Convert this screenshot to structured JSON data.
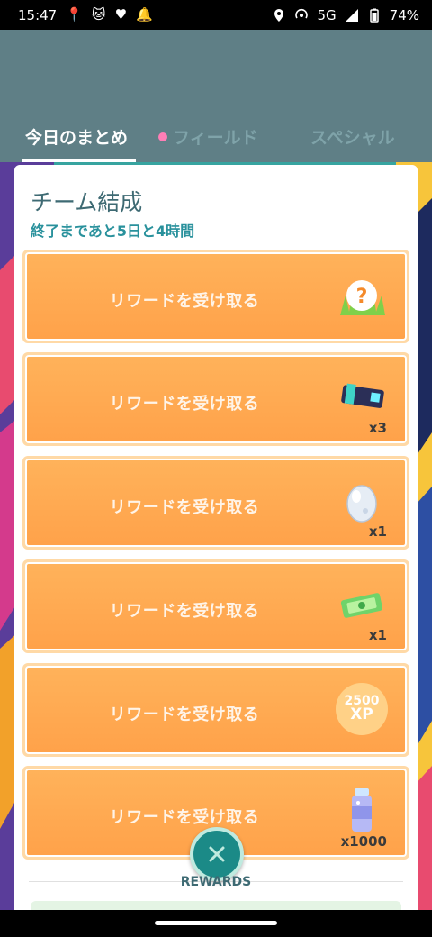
{
  "status_bar": {
    "time": "15:47",
    "network": "5G",
    "battery": "74%"
  },
  "tabs": [
    {
      "label": "今日のまとめ"
    },
    {
      "label": "フィールド"
    },
    {
      "label": "スペシャル"
    }
  ],
  "card": {
    "title": "チーム結成",
    "subtitle": "終了まであと5日と4時間"
  },
  "rewards": [
    {
      "label": "リワードを受け取る",
      "icon": "mystery-encounter-icon",
      "count": ""
    },
    {
      "label": "リワードを受け取る",
      "icon": "raid-pass-icon",
      "count": "x3"
    },
    {
      "label": "リワードを受け取る",
      "icon": "egg-icon",
      "count": "x1"
    },
    {
      "label": "リワードを受け取る",
      "icon": "ticket-icon",
      "count": "x1"
    },
    {
      "label": "リワードを受け取る",
      "icon": "xp-icon",
      "xp_amount": "2500",
      "xp_unit": "XP",
      "count": ""
    },
    {
      "label": "リワードを受け取る",
      "icon": "stardust-spray-icon",
      "count": "x1000"
    }
  ],
  "footer": {
    "rewards_label": "REWARDS"
  },
  "colors": {
    "header_bg": "#5f7f86",
    "accent_teal": "#29919c",
    "reward_orange": "#ffa24a",
    "close_button": "#1b8a87"
  }
}
